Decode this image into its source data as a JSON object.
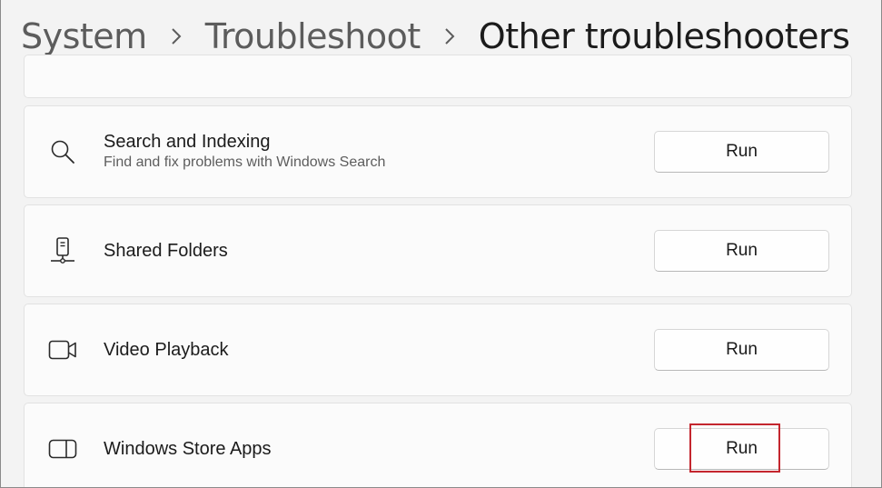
{
  "breadcrumb": {
    "items": [
      {
        "label": "System"
      },
      {
        "label": "Troubleshoot"
      },
      {
        "label": "Other troubleshooters"
      }
    ]
  },
  "troubleshooters": [
    {
      "title": "Search and Indexing",
      "description": "Find and fix problems with Windows Search",
      "button": "Run",
      "icon": "search-icon"
    },
    {
      "title": "Shared Folders",
      "description": "",
      "button": "Run",
      "icon": "shared-folder-icon"
    },
    {
      "title": "Video Playback",
      "description": "",
      "button": "Run",
      "icon": "video-camera-icon"
    },
    {
      "title": "Windows Store Apps",
      "description": "",
      "button": "Run",
      "icon": "store-apps-icon"
    }
  ],
  "colors": {
    "highlight": "#c4262e",
    "background": "#f3f3f3",
    "card": "#fbfbfb"
  }
}
